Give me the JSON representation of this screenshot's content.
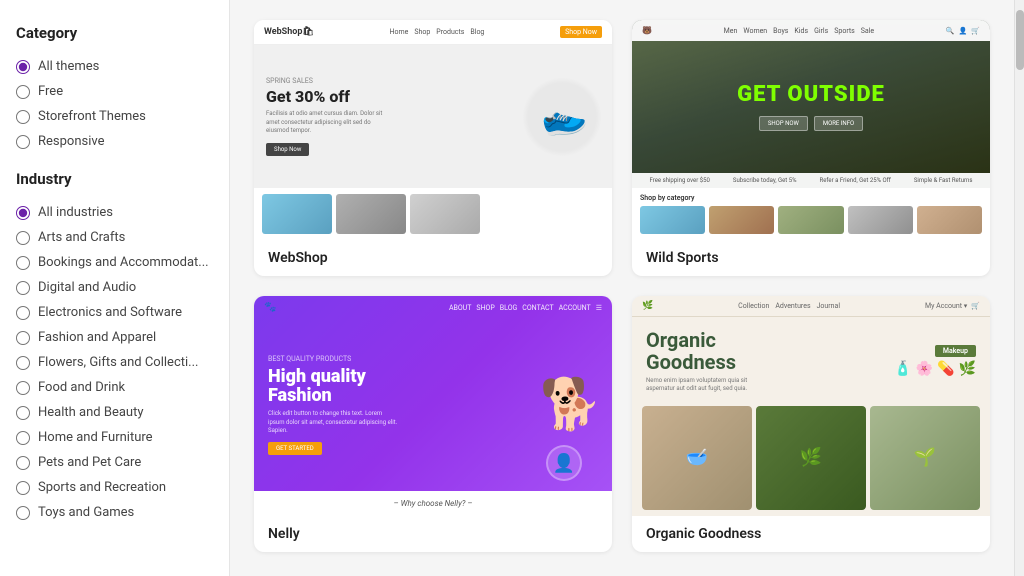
{
  "sidebar": {
    "category_title": "Category",
    "category_options": [
      {
        "id": "all-themes",
        "label": "All themes",
        "checked": true
      },
      {
        "id": "free",
        "label": "Free",
        "checked": false
      },
      {
        "id": "storefront-themes",
        "label": "Storefront Themes",
        "checked": false
      },
      {
        "id": "responsive",
        "label": "Responsive",
        "checked": false
      }
    ],
    "industry_title": "Industry",
    "industry_options": [
      {
        "id": "all-industries",
        "label": "All industries",
        "checked": true
      },
      {
        "id": "arts-and-crafts",
        "label": "Arts and Crafts",
        "checked": false
      },
      {
        "id": "bookings",
        "label": "Bookings and Accommodat...",
        "checked": false
      },
      {
        "id": "digital-audio",
        "label": "Digital and Audio",
        "checked": false
      },
      {
        "id": "electronics",
        "label": "Electronics and Software",
        "checked": false
      },
      {
        "id": "fashion",
        "label": "Fashion and Apparel",
        "checked": false
      },
      {
        "id": "flowers",
        "label": "Flowers, Gifts and Collecti...",
        "checked": false
      },
      {
        "id": "food-drink",
        "label": "Food and Drink",
        "checked": false
      },
      {
        "id": "health-beauty",
        "label": "Health and Beauty",
        "checked": false
      },
      {
        "id": "home-furniture",
        "label": "Home and Furniture",
        "checked": false
      },
      {
        "id": "pets",
        "label": "Pets and Pet Care",
        "checked": false
      },
      {
        "id": "sports",
        "label": "Sports and Recreation",
        "checked": false
      },
      {
        "id": "toys-games",
        "label": "Toys and Games",
        "checked": false
      }
    ]
  },
  "themes": [
    {
      "id": "webshop",
      "name": "WebShop",
      "hero_sale": "SPRING SALES",
      "hero_title": "Get 30% off",
      "hero_desc": "Facilisis at odio amet cursus diam. Dolor sit amet consectetur adipiscing elit sed do eiusmod tempor.",
      "hero_cta": "Shop Now"
    },
    {
      "id": "wild-sports",
      "name": "Wild Sports",
      "hero_title": "GET OUTSIDE",
      "info_1": "Free shipping over $50",
      "info_2": "Subscribe today, Get 5%",
      "info_3": "Refer a Friend, Get 25% Off",
      "info_4": "Simple & Fast Returns",
      "cat_title": "Shop by category"
    },
    {
      "id": "nelly",
      "name": "Nelly",
      "tag": "BEST QUALITY PRODUCTS",
      "title_line1": "High quality",
      "title_line2": "Fashion",
      "desc": "Click edit button to change this text. Lorem ipsum dolor sit amet, consectetur adipiscing elit. Sapien.",
      "cta": "GET STARTED",
      "sub": "– Why choose Nelly? –"
    },
    {
      "id": "organic-goodness",
      "name": "Organic Goodness",
      "title_line1": "Organic",
      "title_line2": "Goodness",
      "side_label": "Makeup"
    }
  ]
}
